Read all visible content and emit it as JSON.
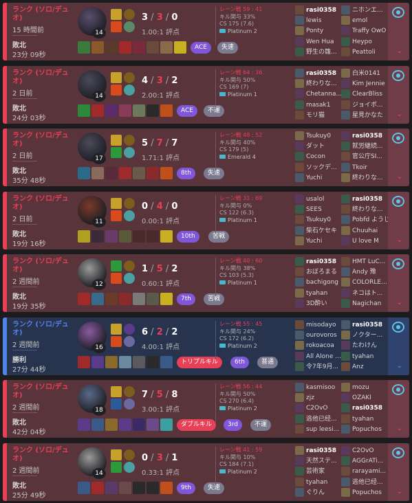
{
  "matches": [
    {
      "queue": "ランク (ソロ/デュオ)",
      "ago": "15 時間前",
      "result": "敗北",
      "duration": "23分 09秒",
      "outcome": "loss",
      "level": "14",
      "k": "3",
      "d": "3",
      "a": "0",
      "ratio": "1.00:1 評点",
      "lane": "レーン戦 59 : 41",
      "kp": "キル関与 33%",
      "cs": "CS 175 (7.6)",
      "tier": "Platinum 2",
      "champ_color": "#5a4f6e",
      "spells": [
        "#c7a12a",
        "#d94b1a"
      ],
      "runes": [
        "#7c5d1e",
        "#5a8a6a"
      ],
      "items": [
        "#3a7a3a",
        "#8a5a2a",
        "#5a3a2a",
        "#a02a2a",
        "#7a2a3a",
        "#6a4a3a",
        "#8a6a4a",
        "#c8b020"
      ],
      "badges": [
        {
          "text": "ACE",
          "cls": "b-purple"
        },
        {
          "text": "失速",
          "cls": "b-gray"
        }
      ],
      "team1": [
        "rasi0358",
        "lewis",
        "Ponty",
        "Wen Hua",
        "野生の雛..."
      ],
      "team2": [
        "ニホンエ...",
        "emol",
        "Traffy OwO",
        "Heypo",
        "Peattoli"
      ],
      "me_team": 1,
      "me_idx": 0
    },
    {
      "queue": "ランク (ソロ/デュオ)",
      "ago": "2 日前",
      "result": "敗北",
      "duration": "24分 03秒",
      "outcome": "loss",
      "level": "14",
      "k": "4",
      "d": "3",
      "a": "2",
      "ratio": "2.00:1 評点",
      "lane": "レーン戦 64 : 36",
      "kp": "キル関与 50%",
      "cs": "CS 169 (7)",
      "tier": "Platinum 1",
      "champ_color": "#4a4a5a",
      "spells": [
        "#c7a12a",
        "#d94b1a"
      ],
      "runes": [
        "#7c5d1e",
        "#4aa0a0"
      ],
      "items": [
        "#2a8a3a",
        "#a02a2a",
        "#5a2a6a",
        "#8a3a5a",
        "#6a7a5a",
        "#2a2a2a",
        "#c0501a"
      ],
      "badges": [
        {
          "text": "ACE",
          "cls": "b-purple"
        },
        {
          "text": "不運",
          "cls": "b-gray"
        }
      ],
      "team1": [
        "rasi0358",
        "終わりな...",
        "Chetanna...",
        "masak1",
        "モリ猫"
      ],
      "team2": [
        "白米0141",
        "Kim Jennie",
        "ClearBliss",
        "ジョイボ...",
        "星見かなた"
      ],
      "me_team": 1,
      "me_idx": 0
    },
    {
      "queue": "ランク (ソロ/デュオ)",
      "ago": "2 日前",
      "result": "敗北",
      "duration": "35分 48秒",
      "outcome": "loss",
      "level": "17",
      "k": "5",
      "d": "7",
      "a": "7",
      "ratio": "1.71:1 評点",
      "lane": "レーン戦 48 : 52",
      "kp": "キル関与 40%",
      "cs": "CS 179 (5)",
      "tier": "Emerald 4",
      "champ_color": "#4a4a5a",
      "spells": [
        "#c7a12a",
        "#2a9a3a"
      ],
      "runes": [
        "#7c5d1e",
        "#4aa0a0"
      ],
      "items": [
        "#2a6a8a",
        "#8a6a5a",
        "#5a2a3a",
        "#a02a2a",
        "#6a5a4a",
        "#8a2a2a",
        "#c0501a"
      ],
      "badges": [
        {
          "text": "8th",
          "cls": "b-purple"
        },
        {
          "text": "失速",
          "cls": "b-gray"
        }
      ],
      "team1": [
        "Tsukuy0",
        "ダット",
        "Cocon",
        "ソックデ...",
        "Yuchi"
      ],
      "team2": [
        "rasi0358",
        "就労継続...",
        "官公庁SI...",
        "Tkoir",
        "終わりな..."
      ],
      "me_team": 2,
      "me_idx": 0
    },
    {
      "queue": "ランク (ソロ/デュオ)",
      "ago": "2 日前",
      "result": "敗北",
      "duration": "19分 16秒",
      "outcome": "loss",
      "level": "11",
      "k": "0",
      "d": "4",
      "a": "0",
      "ratio": "0.00:1 評点",
      "lane": "レーン戦 31 : 69",
      "kp": "キル関与 0%",
      "cs": "CS 122 (6.3)",
      "tier": "Platinum 1",
      "champ_color": "#7a3a2a",
      "spells": [
        "#c7a12a",
        "#d94b1a"
      ],
      "runes": [
        "#7c5d1e",
        "#4aa0a0"
      ],
      "items": [
        "#b0a020",
        "#3a2a3a",
        "#6a3a6a",
        "#5a5a3a",
        "#4a2a2a",
        "#4a2a2a",
        "#c8b020"
      ],
      "badges": [
        {
          "text": "10th",
          "cls": "b-purple"
        },
        {
          "text": "苦戦",
          "cls": "b-gray"
        }
      ],
      "team1": [
        "usalol",
        "SEES",
        "Tsukuy0",
        "柴石ケセキ",
        "Yuchi"
      ],
      "team2": [
        "rasi0358",
        "終わりな...",
        "Pobfd ようじ",
        "Chuuhai",
        "U love M"
      ],
      "me_team": 2,
      "me_idx": 0
    },
    {
      "queue": "ランク (ソロ/デュオ)",
      "ago": "2 週間前",
      "result": "敗北",
      "duration": "19分 35秒",
      "outcome": "loss",
      "level": "12",
      "k": "1",
      "d": "5",
      "a": "2",
      "ratio": "0.60:1 評点",
      "lane": "レーン戦 40 : 60",
      "kp": "キル関与 38%",
      "cs": "CS 103 (5.3)",
      "tier": "Platinum 1",
      "champ_color": "#9a9a9a",
      "spells": [
        "#2a9a3a",
        "#d94b1a"
      ],
      "runes": [
        "#7c5d1e",
        "#4aa0a0"
      ],
      "items": [
        "#a02a2a",
        "#3a6a8a",
        "#6a3a2a",
        "#8a2a2a",
        "#7a7a7a",
        "#5a5a4a",
        "#c8b020"
      ],
      "badges": [
        {
          "text": "7th",
          "cls": "b-purple"
        },
        {
          "text": "苦戦",
          "cls": "b-gray"
        }
      ],
      "team1": [
        "rasi0358",
        "おぼろまる",
        "bachigong",
        "tyahan",
        "3D酔い"
      ],
      "team2": [
        "HMT LuC...",
        "Andy 豫",
        "COLORLE...",
        "ネコはト...",
        "Nagichan"
      ],
      "me_team": 1,
      "me_idx": 0
    },
    {
      "queue": "ランク (ソロ/デュオ)",
      "ago": "2 週間前",
      "result": "勝利",
      "duration": "27分 44秒",
      "outcome": "win",
      "level": "16",
      "k": "6",
      "d": "2",
      "a": "2",
      "ratio": "4.00:1 評点",
      "lane": "レーン戦 55 : 45",
      "kp": "キル関与 24%",
      "cs": "CS 172 (6.2)",
      "tier": "Platinum 2",
      "champ_color": "#8a5aa0",
      "spells": [
        "#c7a12a",
        "#d94b1a"
      ],
      "runes": [
        "#5a3a8a",
        "#6a6aa0"
      ],
      "items": [
        "#a02a2a",
        "#5a3a8a",
        "#8a6a2a",
        "#6a8aa0",
        "#5a5a5a",
        "#2a2a2a",
        "#3a5a8a"
      ],
      "badges": [
        {
          "text": "トリプルキル",
          "cls": "b-red"
        },
        {
          "text": "6th",
          "cls": "b-purple"
        },
        {
          "text": "普通",
          "cls": "b-gray"
        }
      ],
      "team1": [
        "misodayo",
        "ourovoros",
        "rokoacoa",
        "All Alone ...",
        "令7年9月..."
      ],
      "team2": [
        "rasi0358",
        "ノクター...",
        "たわけん",
        "tyahan",
        "Anz"
      ],
      "me_team": 2,
      "me_idx": 0
    },
    {
      "queue": "ランク (ソロ/デュオ)",
      "ago": "2 週間前",
      "result": "敗北",
      "duration": "42分 04秒",
      "outcome": "loss",
      "level": "18",
      "k": "7",
      "d": "5",
      "a": "8",
      "ratio": "3.00:1 評点",
      "lane": "レーン戦 56 : 44",
      "kp": "キル関与 50%",
      "cs": "CS 270 (6.4)",
      "tier": "Platinum 2",
      "champ_color": "#5a6a8a",
      "spells": [
        "#c7a12a",
        "#2a5a9a"
      ],
      "runes": [
        "#7c5d1e",
        "#6a6aa0"
      ],
      "items": [
        "#5a3a8a",
        "#3a5a8a",
        "#8a6a2a",
        "#5a3a8a",
        "#3a2a6a",
        "#6a4a8a",
        "#3aa0a0"
      ],
      "badges": [
        {
          "text": "ダブルキル",
          "cls": "b-red"
        },
        {
          "text": "3rd",
          "cls": "b-purple"
        },
        {
          "text": "不運",
          "cls": "b-gray"
        }
      ],
      "team1": [
        "kasmisoo",
        "zjz",
        "C2OvO",
        "逃他已经...",
        "sup leesi..."
      ],
      "team2": [
        "mozu",
        "OZAKI",
        "rasi0358",
        "tyahan",
        "Popuchos"
      ],
      "me_team": 2,
      "me_idx": 2
    },
    {
      "queue": "ランク (ソロ/デュオ)",
      "ago": "2 週間前",
      "result": "敗北",
      "duration": "25分 49秒",
      "outcome": "loss",
      "level": "14",
      "k": "0",
      "d": "3",
      "a": "1",
      "ratio": "0.33:1 評点",
      "lane": "レーン戦 41 : 59",
      "kp": "キル関与 10%",
      "cs": "CS 184 (7.1)",
      "tier": "Platinum 2",
      "champ_color": "#9a9a9a",
      "spells": [
        "#c7a12a",
        "#2a9a3a"
      ],
      "runes": [
        "#7c5d1e",
        "#4aa0a0"
      ],
      "items": [
        "#3a5a8a",
        "#a02a2a",
        "#5a3a6a",
        "#6a4a4a",
        "#2a2a2a",
        "#2a2a2a",
        "#c0501a"
      ],
      "badges": [
        {
          "text": "9th",
          "cls": "b-purple"
        },
        {
          "text": "失速",
          "cls": "b-gray"
        }
      ],
      "team1": [
        "rasi0358",
        "天然ステ...",
        "芸術家",
        "tyahan",
        "ぐりん"
      ],
      "team2": [
        "C2OvO",
        "AGGrATi...",
        "rarayami...",
        "逃他已经...",
        "Popuchos"
      ],
      "me_team": 1,
      "me_idx": 0
    }
  ]
}
